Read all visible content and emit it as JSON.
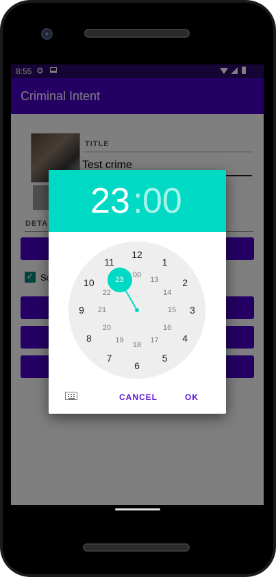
{
  "status_bar": {
    "time": "8:55",
    "gear_icon": "gear-icon",
    "download_icon": "download-icon"
  },
  "app_bar": {
    "title": "Criminal Intent"
  },
  "crime_form": {
    "title_label": "TITLE",
    "title_value": "Test crime",
    "details_label": "DETA",
    "solved_label": "So"
  },
  "time_picker": {
    "hour": "23",
    "separator": ":",
    "minute": "00",
    "selected_hour": 23,
    "outer_numbers": [
      "12",
      "1",
      "2",
      "3",
      "4",
      "5",
      "6",
      "7",
      "8",
      "9",
      "10",
      "11"
    ],
    "inner_numbers": [
      "00",
      "13",
      "14",
      "15",
      "16",
      "17",
      "18",
      "19",
      "20",
      "21",
      "22",
      "23"
    ],
    "cancel_label": "CANCEL",
    "ok_label": "OK",
    "keyboard_icon": "keyboard-icon"
  },
  "colors": {
    "accent": "#00d9c4",
    "primary": "#4a00c8",
    "status_bar": "#2b0a6b",
    "button_text": "#5c12d6"
  }
}
